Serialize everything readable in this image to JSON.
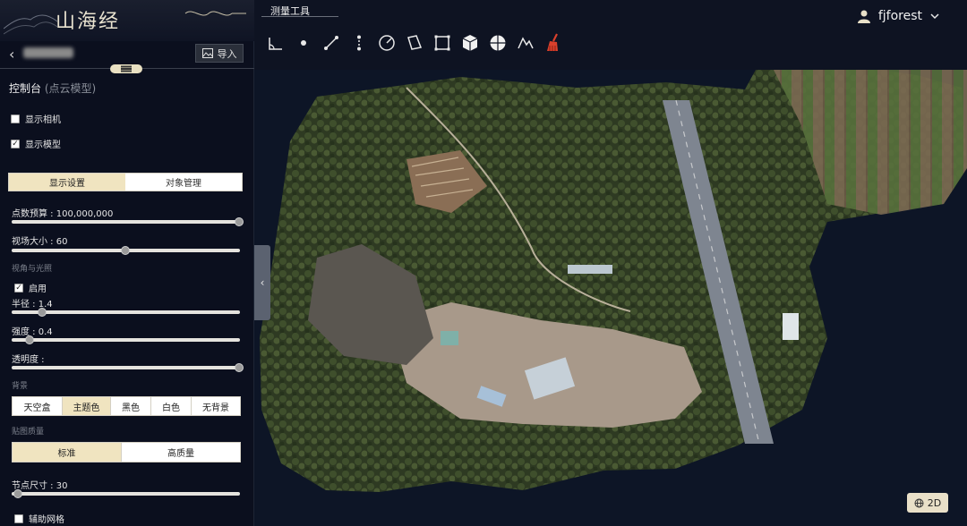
{
  "app": {
    "logo_text": "山海经"
  },
  "sidebar": {
    "import_label": "导入",
    "panel_title": "控制台",
    "panel_subtitle": "(点云模型)",
    "show_camera": {
      "label": "显示相机",
      "checked": false
    },
    "show_model": {
      "label": "显示模型",
      "checked": true
    },
    "tabs": [
      {
        "label": "显示设置",
        "active": true
      },
      {
        "label": "对象管理",
        "active": false
      }
    ],
    "point_budget": {
      "label": "点数预算 : 100,000,000",
      "value": 1.0
    },
    "fov": {
      "label": "视场大小 : 60",
      "value": 0.5
    },
    "edl_section": "视角与光照",
    "enable": {
      "label": "启用",
      "checked": true
    },
    "radius": {
      "label": "半径 : 1.4",
      "value": 0.12
    },
    "strength": {
      "label": "强度 : 0.4",
      "value": 0.07
    },
    "opacity": {
      "label": "透明度 :",
      "value": 1.0
    },
    "background_section": "背景",
    "background_options": [
      {
        "label": "天空盒",
        "active": false
      },
      {
        "label": "主题色",
        "active": true
      },
      {
        "label": "黑色",
        "active": false
      },
      {
        "label": "白色",
        "active": false
      },
      {
        "label": "无背景",
        "active": false
      }
    ],
    "texture_section": "贴图质量",
    "texture_options": [
      {
        "label": "标准",
        "active": true
      },
      {
        "label": "高质量",
        "active": false
      }
    ],
    "node_size": {
      "label": "节点尺寸 : 30",
      "value": 0.03
    },
    "grid": {
      "label": "辅助网格",
      "checked": false
    }
  },
  "toolbar": {
    "title": "测量工具",
    "tools": [
      "angle-icon",
      "point-icon",
      "distance-icon",
      "height-icon",
      "circle-icon",
      "area-icon",
      "volume-icon",
      "cube-icon",
      "sphere-icon",
      "profile-icon",
      "clear-icon"
    ]
  },
  "user": {
    "name": "fjforest"
  },
  "map": {
    "view_mode_label": "2D"
  }
}
